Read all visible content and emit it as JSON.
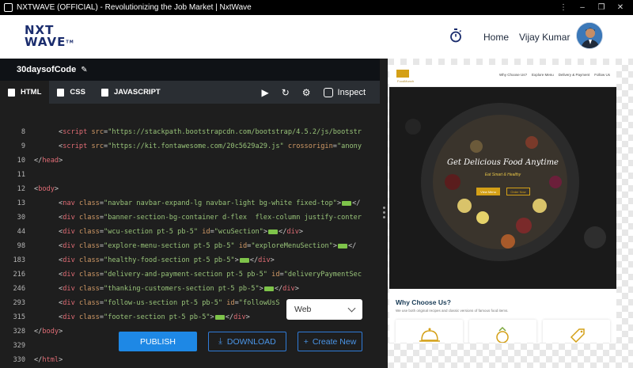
{
  "window": {
    "title": "NXTWAVE (OFFICIAL) - Revolutionizing the Job Market | NxtWave"
  },
  "header": {
    "logo_top": "NXT",
    "logo_bottom": "WAVE",
    "logo_tm": "TM",
    "nav_home": "Home",
    "user_name": "Vijay Kumar"
  },
  "project": {
    "name": "30daysofCode"
  },
  "tabs": [
    {
      "label": "HTML",
      "icon": "html5-icon"
    },
    {
      "label": "CSS",
      "icon": "css3-icon"
    },
    {
      "label": "JAVASCRIPT",
      "icon": "js-file-icon"
    }
  ],
  "toolbar": {
    "inspect_label": "Inspect"
  },
  "code_lines": [
    {
      "n": "8",
      "indent": "    ",
      "parts": [
        [
          "punct",
          "<"
        ],
        [
          "tag",
          "script"
        ],
        [
          "src",
          " "
        ],
        [
          "attr",
          "src"
        ],
        [
          "punct",
          "="
        ],
        [
          "str",
          "\"https://stackpath.bootstrapcdn.com/bootstrap/4.5.2/js/bootstr"
        ]
      ]
    },
    {
      "n": "9",
      "indent": "    ",
      "parts": [
        [
          "punct",
          "<"
        ],
        [
          "tag",
          "script"
        ],
        [
          "src",
          " "
        ],
        [
          "attr",
          "src"
        ],
        [
          "punct",
          "="
        ],
        [
          "str",
          "\"https://kit.fontawesome.com/20c5629a29.js\""
        ],
        [
          "src",
          " "
        ],
        [
          "attr",
          "crossorigin"
        ],
        [
          "punct",
          "="
        ],
        [
          "str",
          "\"anony"
        ]
      ]
    },
    {
      "n": "10",
      "indent": "",
      "parts": [
        [
          "punct",
          "</"
        ],
        [
          "tag",
          "head"
        ],
        [
          "punct",
          ">"
        ]
      ]
    },
    {
      "n": "11",
      "indent": "",
      "parts": []
    },
    {
      "n": "12",
      "indent": "",
      "parts": [
        [
          "punct",
          "<"
        ],
        [
          "tag",
          "body"
        ],
        [
          "punct",
          ">"
        ]
      ]
    },
    {
      "n": "13",
      "indent": "    ",
      "parts": [
        [
          "punct",
          "<"
        ],
        [
          "tag",
          "nav"
        ],
        [
          "src",
          " "
        ],
        [
          "attr",
          "class"
        ],
        [
          "punct",
          "="
        ],
        [
          "str",
          "\"navbar navbar-expand-lg navbar-light bg-white fixed-top\""
        ],
        [
          "punct",
          ">"
        ],
        [
          "fold",
          ""
        ],
        [
          "punct",
          "</"
        ]
      ]
    },
    {
      "n": "30",
      "indent": "    ",
      "parts": [
        [
          "punct",
          "<"
        ],
        [
          "tag",
          "div"
        ],
        [
          "src",
          " "
        ],
        [
          "attr",
          "class"
        ],
        [
          "punct",
          "="
        ],
        [
          "str",
          "\"banner-section-bg-container d-flex  flex-column justify-conter"
        ]
      ]
    },
    {
      "n": "44",
      "indent": "    ",
      "parts": [
        [
          "punct",
          "<"
        ],
        [
          "tag",
          "div"
        ],
        [
          "src",
          " "
        ],
        [
          "attr",
          "class"
        ],
        [
          "punct",
          "="
        ],
        [
          "str",
          "\"wcu-section pt-5 pb-5\""
        ],
        [
          "src",
          " "
        ],
        [
          "attr",
          "id"
        ],
        [
          "punct",
          "="
        ],
        [
          "str",
          "\"wcuSection\""
        ],
        [
          "punct",
          ">"
        ],
        [
          "fold",
          ""
        ],
        [
          "punct",
          "</"
        ],
        [
          "tag",
          "div"
        ],
        [
          "punct",
          ">"
        ]
      ]
    },
    {
      "n": "98",
      "indent": "    ",
      "parts": [
        [
          "punct",
          "<"
        ],
        [
          "tag",
          "div"
        ],
        [
          "src",
          " "
        ],
        [
          "attr",
          "class"
        ],
        [
          "punct",
          "="
        ],
        [
          "str",
          "\"explore-menu-section pt-5 pb-5\""
        ],
        [
          "src",
          " "
        ],
        [
          "attr",
          "id"
        ],
        [
          "punct",
          "="
        ],
        [
          "str",
          "\"exploreMenuSection\""
        ],
        [
          "punct",
          ">"
        ],
        [
          "fold",
          ""
        ],
        [
          "punct",
          "</"
        ]
      ]
    },
    {
      "n": "183",
      "indent": "    ",
      "parts": [
        [
          "punct",
          "<"
        ],
        [
          "tag",
          "div"
        ],
        [
          "src",
          " "
        ],
        [
          "attr",
          "class"
        ],
        [
          "punct",
          "="
        ],
        [
          "str",
          "\"healthy-food-section pt-5 pb-5\""
        ],
        [
          "punct",
          ">"
        ],
        [
          "fold",
          ""
        ],
        [
          "punct",
          "</"
        ],
        [
          "tag",
          "div"
        ],
        [
          "punct",
          ">"
        ]
      ]
    },
    {
      "n": "216",
      "indent": "    ",
      "parts": [
        [
          "punct",
          "<"
        ],
        [
          "tag",
          "div"
        ],
        [
          "src",
          " "
        ],
        [
          "attr",
          "class"
        ],
        [
          "punct",
          "="
        ],
        [
          "str",
          "\"delivery-and-payment-section pt-5 pb-5\""
        ],
        [
          "src",
          " "
        ],
        [
          "attr",
          "id"
        ],
        [
          "punct",
          "="
        ],
        [
          "str",
          "\"deliveryPaymentSec"
        ]
      ]
    },
    {
      "n": "246",
      "indent": "    ",
      "parts": [
        [
          "punct",
          "<"
        ],
        [
          "tag",
          "div"
        ],
        [
          "src",
          " "
        ],
        [
          "attr",
          "class"
        ],
        [
          "punct",
          "="
        ],
        [
          "str",
          "\"thanking-customers-section pt-5 pb-5\""
        ],
        [
          "punct",
          ">"
        ],
        [
          "fold",
          ""
        ],
        [
          "punct",
          "</"
        ],
        [
          "tag",
          "div"
        ],
        [
          "punct",
          ">"
        ]
      ]
    },
    {
      "n": "293",
      "indent": "    ",
      "parts": [
        [
          "punct",
          "<"
        ],
        [
          "tag",
          "div"
        ],
        [
          "src",
          " "
        ],
        [
          "attr",
          "class"
        ],
        [
          "punct",
          "="
        ],
        [
          "str",
          "\"follow-us-section pt-5 pb-5\""
        ],
        [
          "src",
          " "
        ],
        [
          "attr",
          "id"
        ],
        [
          "punct",
          "="
        ],
        [
          "str",
          "\"followUsS"
        ]
      ]
    },
    {
      "n": "315",
      "indent": "    ",
      "parts": [
        [
          "punct",
          "<"
        ],
        [
          "tag",
          "div"
        ],
        [
          "src",
          " "
        ],
        [
          "attr",
          "class"
        ],
        [
          "punct",
          "="
        ],
        [
          "str",
          "\"footer-section pt-5 pb-5\""
        ],
        [
          "punct",
          ">"
        ],
        [
          "fold",
          ""
        ],
        [
          "punct",
          "</"
        ],
        [
          "tag",
          "div"
        ],
        [
          "punct",
          ">"
        ]
      ]
    },
    {
      "n": "328",
      "indent": "",
      "parts": [
        [
          "punct",
          "</"
        ],
        [
          "tag",
          "body"
        ],
        [
          "punct",
          ">"
        ]
      ]
    },
    {
      "n": "329",
      "indent": "",
      "parts": []
    },
    {
      "n": "330",
      "indent": "",
      "parts": [
        [
          "punct",
          "</"
        ],
        [
          "tag",
          "html"
        ],
        [
          "punct",
          ">"
        ]
      ]
    }
  ],
  "device_select": {
    "value": "Web"
  },
  "actions": {
    "publish": "PUBLISH",
    "download": "DOWNLOAD",
    "create_new": "Create New"
  },
  "preview": {
    "logo_text": "FoodMunch",
    "nav_links": [
      "Why Choose Us?",
      "Explore Menu",
      "Delivery & Payment",
      "Follow Us"
    ],
    "banner_title": "Get Delicious Food Anytime",
    "banner_subtitle": "Eat Smart & Healthy",
    "banner_btn_primary": "View Menu",
    "banner_btn_secondary": "Order Now",
    "wcu_title": "Why Choose Us?",
    "wcu_subtitle": "We use both original recipes and classic versions of famous food items."
  },
  "colors": {
    "publish_blue": "#1e88e5",
    "brand_navy": "#1a2c6d",
    "food_gold": "#d4a017"
  }
}
